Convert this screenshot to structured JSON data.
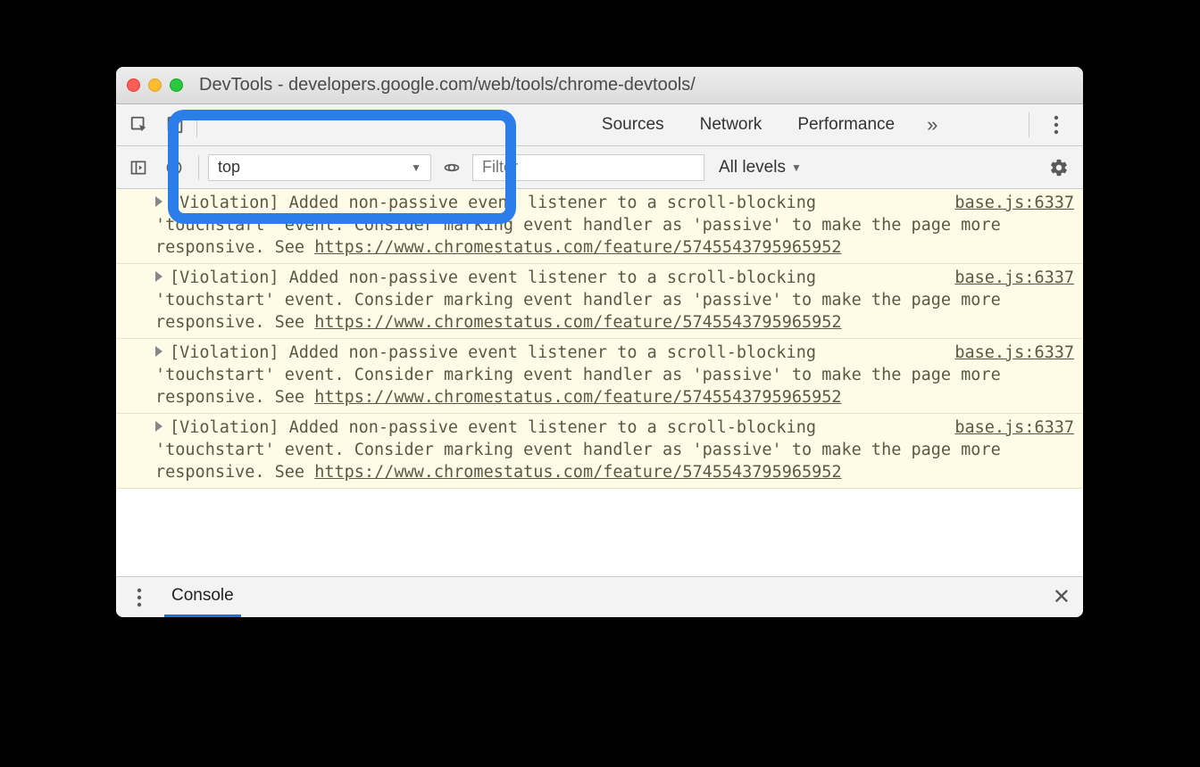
{
  "window": {
    "title": "DevTools - developers.google.com/web/tools/chrome-devtools/"
  },
  "tabs": {
    "sources": "Sources",
    "network": "Network",
    "performance": "Performance"
  },
  "toolbar": {
    "context": "top",
    "filter_placeholder": "Filter",
    "levels": "All levels"
  },
  "messages": [
    {
      "prefix": "[Violation] ",
      "body": "Added non-passive event listener to a scroll-blocking 'touchstart' event. Consider marking event handler as 'passive' to make the page more responsive. See ",
      "link": "https://www.chromestatus.com/feature/5745543795965952",
      "source": "base.js:6337"
    },
    {
      "prefix": "[Violation] ",
      "body": "Added non-passive event listener to a scroll-blocking 'touchstart' event. Consider marking event handler as 'passive' to make the page more responsive. See ",
      "link": "https://www.chromestatus.com/feature/5745543795965952",
      "source": "base.js:6337"
    },
    {
      "prefix": "[Violation] ",
      "body": "Added non-passive event listener to a scroll-blocking 'touchstart' event. Consider marking event handler as 'passive' to make the page more responsive. See ",
      "link": "https://www.chromestatus.com/feature/5745543795965952",
      "source": "base.js:6337"
    },
    {
      "prefix": "[Violation] ",
      "body": "Added non-passive event listener to a scroll-blocking 'touchstart' event. Consider marking event handler as 'passive' to make the page more responsive. See ",
      "link": "https://www.chromestatus.com/feature/5745543795965952",
      "source": "base.js:6337"
    }
  ],
  "drawer": {
    "tab": "Console"
  }
}
